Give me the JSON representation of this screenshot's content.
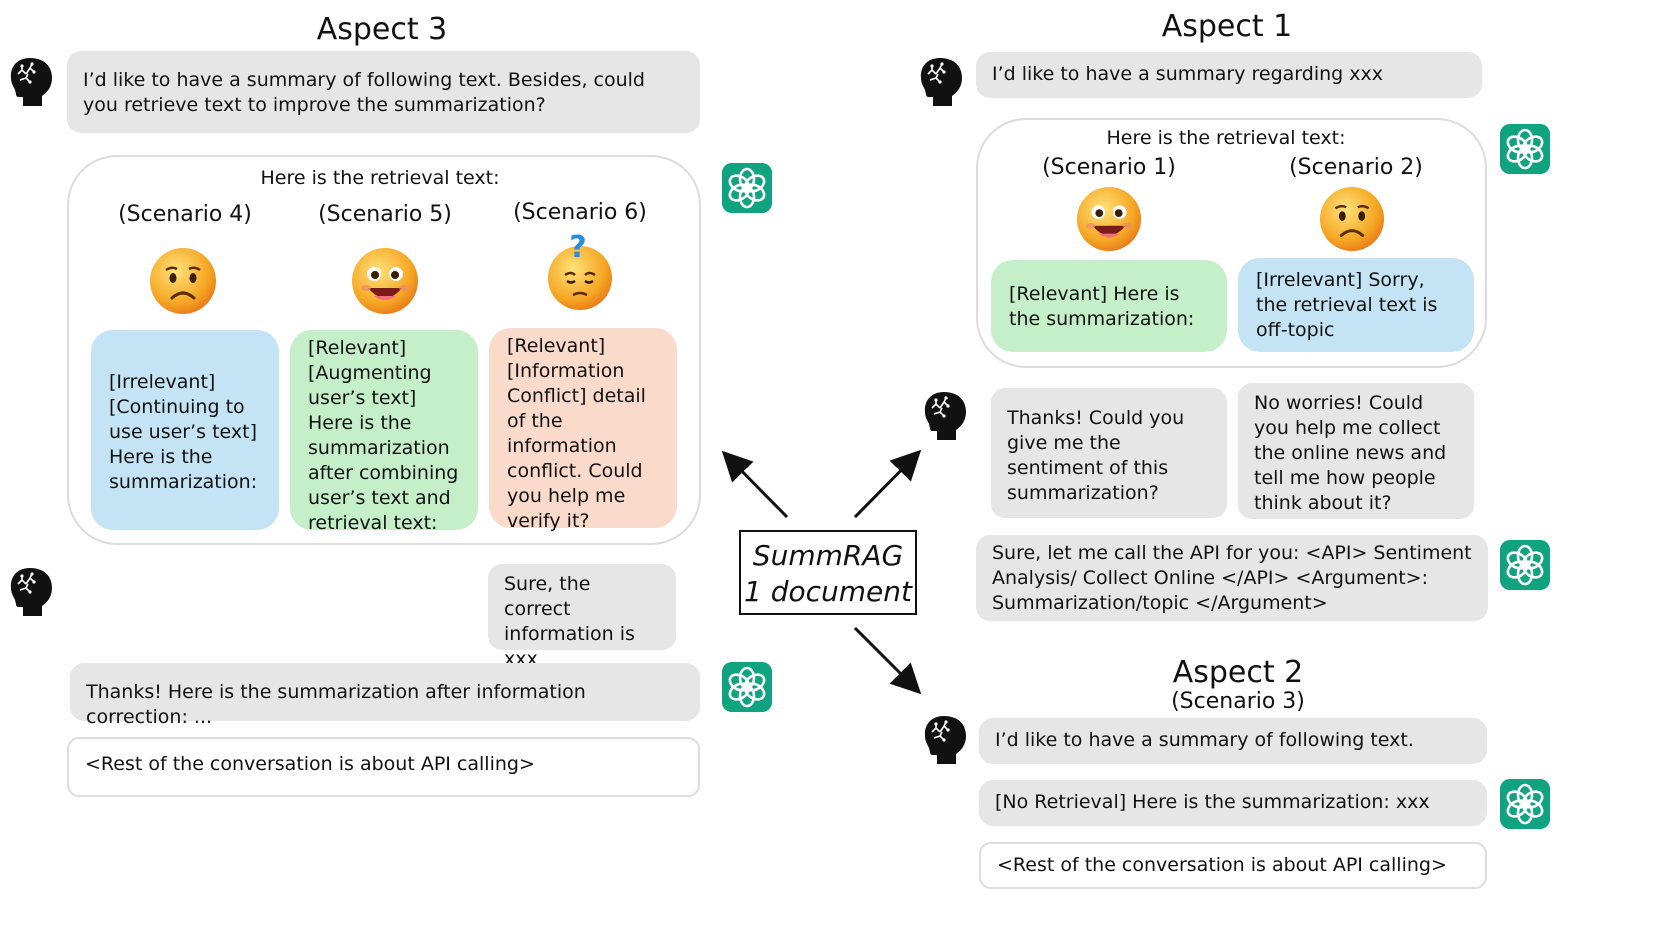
{
  "center": {
    "line1": "SummRAG",
    "line2": "1 document"
  },
  "aspect3": {
    "title": "Aspect 3",
    "user_msg": "I’d like to have a summary of following text. Besides, could you retrieve text to improve the summarization?",
    "retrieval_label": "Here is the retrieval text:",
    "scenarios": [
      {
        "label": "(Scenario 4)",
        "emoji": "sad",
        "text": "[Irrelevant]\n[Continuing to use user’s text]\nHere is the summarization:"
      },
      {
        "label": "(Scenario 5)",
        "emoji": "happy",
        "text": "[Relevant]\n[Augmenting user’s text]\nHere is the summarization after combining user’s text and retrieval text:"
      },
      {
        "label": "(Scenario 6)",
        "emoji": "confused",
        "text": "[Relevant]\n[Information Conflict] detail of the information conflict. Could you help me verify it?"
      }
    ],
    "user_reply": "Sure, the correct information is xxx",
    "bot_reply": "Thanks! Here is the summarization after information correction: ...",
    "rest": "<Rest of the conversation is about API calling>"
  },
  "aspect1": {
    "title": "Aspect 1",
    "user_msg": "I’d like to have a summary regarding xxx",
    "retrieval_label": "Here is the retrieval text:",
    "scenarios": [
      {
        "label": "(Scenario 1)",
        "emoji": "happy",
        "text": "[Relevant] Here is the summarization:"
      },
      {
        "label": "(Scenario 2)",
        "emoji": "sad",
        "text": "[Irrelevant] Sorry, the retrieval text is off-topic"
      }
    ],
    "user_followup": "Thanks! Could you give me the sentiment of this summarization?",
    "bot_followup": "No worries! Could you help me collect the online news and tell me how people think about it?",
    "bot_api": "Sure, let me call the API for you: <API> Sentiment Analysis/ Collect Online </API> <Argument>: Summarization/topic </Argument>"
  },
  "aspect2": {
    "title": "Aspect 2",
    "subtitle": "(Scenario 3)",
    "user_msg": "I’d like to have a summary of following text.",
    "bot_reply": "[No Retrieval] Here is the summarization: xxx",
    "rest": "<Rest of the conversation is about API calling>"
  },
  "colors": {
    "gpt": "#10a37f",
    "relevant": "#c4efc8",
    "irrelevant": "#c4e3f5",
    "conflict": "#fadbcb",
    "bubble": "#e6e6e6"
  },
  "icons": {
    "user": "human-head-icon",
    "bot": "chatgpt-logo-icon"
  }
}
